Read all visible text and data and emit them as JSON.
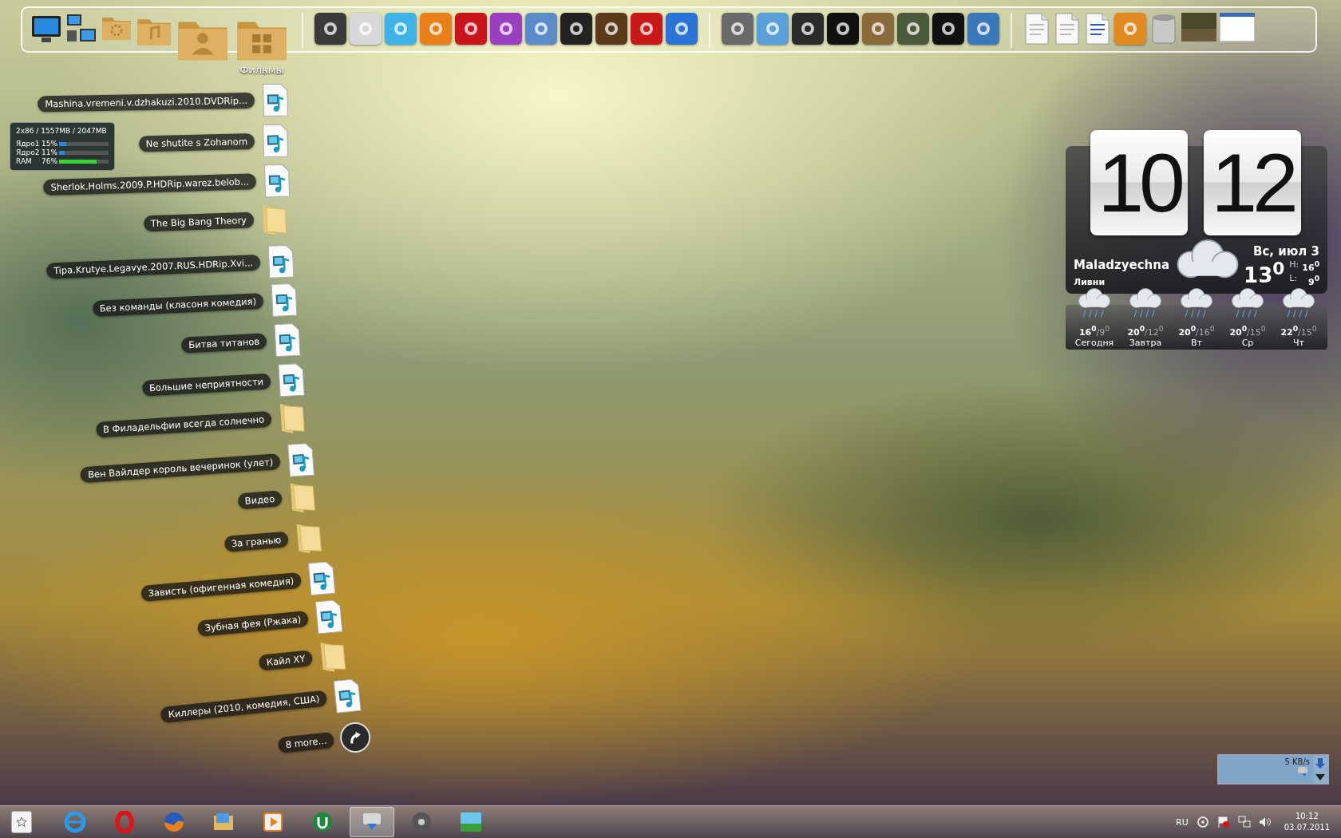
{
  "dock": {
    "label": "Фильмы"
  },
  "fan_stack": {
    "items": [
      {
        "label": "Mashina.vremeni.v.dzhakuzi.2010.DVDRip...",
        "kind": "video"
      },
      {
        "label": "Ne shutite s Zohanom",
        "kind": "video"
      },
      {
        "label": "Sherlok.Holms.2009.P.HDRip.warez.belob...",
        "kind": "video"
      },
      {
        "label": "The Big Bang Theory",
        "kind": "folder"
      },
      {
        "label": "Tipa.Krutye.Legavye.2007.RUS.HDRip.Xvi...",
        "kind": "video"
      },
      {
        "label": "Без команды (класоня комедия)",
        "kind": "video"
      },
      {
        "label": "Битва титанов",
        "kind": "video"
      },
      {
        "label": "Большие неприятности",
        "kind": "video"
      },
      {
        "label": "В Филадельфии всегда солнечно",
        "kind": "folder"
      },
      {
        "label": "Вен Вайлдер король вечеринок (улет)",
        "kind": "video"
      },
      {
        "label": "Видео",
        "kind": "folder"
      },
      {
        "label": "За гранью",
        "kind": "folder"
      },
      {
        "label": "Зависть (офигенная комедия)",
        "kind": "video"
      },
      {
        "label": "Зубная фея (Ржака)",
        "kind": "video"
      },
      {
        "label": "Кайл XY",
        "kind": "folder"
      },
      {
        "label": "Киллеры (2010, комедия, США)",
        "kind": "video"
      }
    ],
    "more": {
      "label": "8 more..."
    }
  },
  "system_monitor": {
    "summary": "2x86 / 1557MB / 2047MB",
    "rows": [
      {
        "name": "Ядро1",
        "reading": "15%",
        "level": 0.15,
        "color": "#2f86e0"
      },
      {
        "name": "Ядро2",
        "reading": "11%",
        "level": 0.11,
        "color": "#2f86e0"
      },
      {
        "name": "RAM",
        "reading": "76%",
        "level": 0.76,
        "color": "#3cd23c"
      }
    ]
  },
  "clock_weather": {
    "hours": "10",
    "minutes": "12",
    "city": "Maladzyechna",
    "condition": "Ливни",
    "date": "Вс, июл 3",
    "temperature": "13$^{0}$",
    "high_label": "H:",
    "high": "16$^{0}$",
    "low_label": "L:",
    "low": "9$^{0}$",
    "forecast": [
      {
        "high": "16$^{0}$",
        "low": "/9$^{0}$",
        "day": "Сегодня"
      },
      {
        "high": "20$^{0}$",
        "low": "/12$^{0}$",
        "day": "Завтра"
      },
      {
        "high": "20$^{0}$",
        "low": "/16$^{0}$",
        "day": "Вт"
      },
      {
        "high": "20$^{0}$",
        "low": "/15$^{0}$",
        "day": "Ср"
      },
      {
        "high": "22$^{0}$",
        "low": "/15$^{0}$",
        "day": "Чт"
      }
    ]
  },
  "network_meter": {
    "speed": "5 KB/s"
  },
  "taskbar": {
    "apps": [
      {
        "active": false
      },
      {
        "active": false
      },
      {
        "active": false
      },
      {
        "active": false
      },
      {
        "active": false
      },
      {
        "active": false
      },
      {
        "active": true
      },
      {
        "active": false
      },
      {
        "active": false
      }
    ]
  },
  "tray": {
    "language": "RU",
    "time": "10:12",
    "date": "03.07.2011"
  }
}
